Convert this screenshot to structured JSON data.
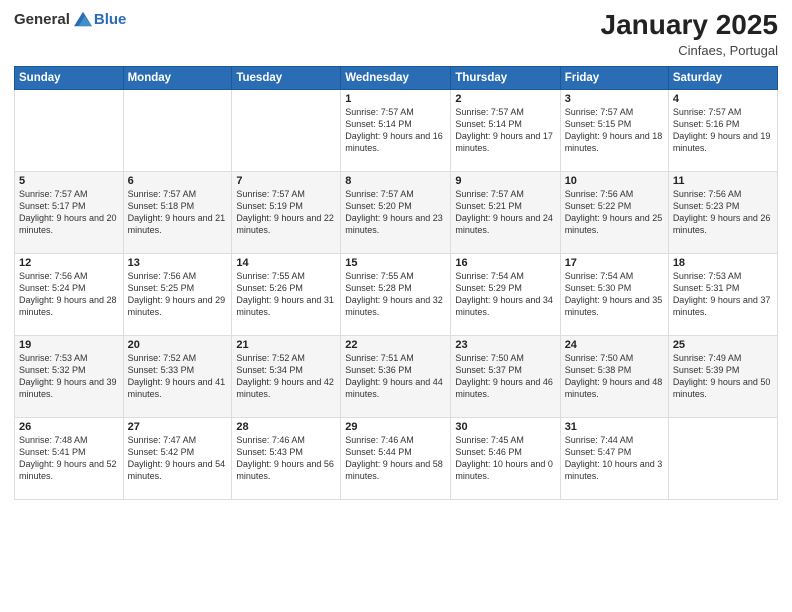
{
  "logo": {
    "text_general": "General",
    "text_blue": "Blue"
  },
  "header": {
    "month": "January 2025",
    "location": "Cinfaes, Portugal"
  },
  "weekdays": [
    "Sunday",
    "Monday",
    "Tuesday",
    "Wednesday",
    "Thursday",
    "Friday",
    "Saturday"
  ],
  "weeks": [
    [
      {
        "day": "",
        "sunrise": "",
        "sunset": "",
        "daylight": ""
      },
      {
        "day": "",
        "sunrise": "",
        "sunset": "",
        "daylight": ""
      },
      {
        "day": "",
        "sunrise": "",
        "sunset": "",
        "daylight": ""
      },
      {
        "day": "1",
        "sunrise": "Sunrise: 7:57 AM",
        "sunset": "Sunset: 5:14 PM",
        "daylight": "Daylight: 9 hours and 16 minutes."
      },
      {
        "day": "2",
        "sunrise": "Sunrise: 7:57 AM",
        "sunset": "Sunset: 5:14 PM",
        "daylight": "Daylight: 9 hours and 17 minutes."
      },
      {
        "day": "3",
        "sunrise": "Sunrise: 7:57 AM",
        "sunset": "Sunset: 5:15 PM",
        "daylight": "Daylight: 9 hours and 18 minutes."
      },
      {
        "day": "4",
        "sunrise": "Sunrise: 7:57 AM",
        "sunset": "Sunset: 5:16 PM",
        "daylight": "Daylight: 9 hours and 19 minutes."
      }
    ],
    [
      {
        "day": "5",
        "sunrise": "Sunrise: 7:57 AM",
        "sunset": "Sunset: 5:17 PM",
        "daylight": "Daylight: 9 hours and 20 minutes."
      },
      {
        "day": "6",
        "sunrise": "Sunrise: 7:57 AM",
        "sunset": "Sunset: 5:18 PM",
        "daylight": "Daylight: 9 hours and 21 minutes."
      },
      {
        "day": "7",
        "sunrise": "Sunrise: 7:57 AM",
        "sunset": "Sunset: 5:19 PM",
        "daylight": "Daylight: 9 hours and 22 minutes."
      },
      {
        "day": "8",
        "sunrise": "Sunrise: 7:57 AM",
        "sunset": "Sunset: 5:20 PM",
        "daylight": "Daylight: 9 hours and 23 minutes."
      },
      {
        "day": "9",
        "sunrise": "Sunrise: 7:57 AM",
        "sunset": "Sunset: 5:21 PM",
        "daylight": "Daylight: 9 hours and 24 minutes."
      },
      {
        "day": "10",
        "sunrise": "Sunrise: 7:56 AM",
        "sunset": "Sunset: 5:22 PM",
        "daylight": "Daylight: 9 hours and 25 minutes."
      },
      {
        "day": "11",
        "sunrise": "Sunrise: 7:56 AM",
        "sunset": "Sunset: 5:23 PM",
        "daylight": "Daylight: 9 hours and 26 minutes."
      }
    ],
    [
      {
        "day": "12",
        "sunrise": "Sunrise: 7:56 AM",
        "sunset": "Sunset: 5:24 PM",
        "daylight": "Daylight: 9 hours and 28 minutes."
      },
      {
        "day": "13",
        "sunrise": "Sunrise: 7:56 AM",
        "sunset": "Sunset: 5:25 PM",
        "daylight": "Daylight: 9 hours and 29 minutes."
      },
      {
        "day": "14",
        "sunrise": "Sunrise: 7:55 AM",
        "sunset": "Sunset: 5:26 PM",
        "daylight": "Daylight: 9 hours and 31 minutes."
      },
      {
        "day": "15",
        "sunrise": "Sunrise: 7:55 AM",
        "sunset": "Sunset: 5:28 PM",
        "daylight": "Daylight: 9 hours and 32 minutes."
      },
      {
        "day": "16",
        "sunrise": "Sunrise: 7:54 AM",
        "sunset": "Sunset: 5:29 PM",
        "daylight": "Daylight: 9 hours and 34 minutes."
      },
      {
        "day": "17",
        "sunrise": "Sunrise: 7:54 AM",
        "sunset": "Sunset: 5:30 PM",
        "daylight": "Daylight: 9 hours and 35 minutes."
      },
      {
        "day": "18",
        "sunrise": "Sunrise: 7:53 AM",
        "sunset": "Sunset: 5:31 PM",
        "daylight": "Daylight: 9 hours and 37 minutes."
      }
    ],
    [
      {
        "day": "19",
        "sunrise": "Sunrise: 7:53 AM",
        "sunset": "Sunset: 5:32 PM",
        "daylight": "Daylight: 9 hours and 39 minutes."
      },
      {
        "day": "20",
        "sunrise": "Sunrise: 7:52 AM",
        "sunset": "Sunset: 5:33 PM",
        "daylight": "Daylight: 9 hours and 41 minutes."
      },
      {
        "day": "21",
        "sunrise": "Sunrise: 7:52 AM",
        "sunset": "Sunset: 5:34 PM",
        "daylight": "Daylight: 9 hours and 42 minutes."
      },
      {
        "day": "22",
        "sunrise": "Sunrise: 7:51 AM",
        "sunset": "Sunset: 5:36 PM",
        "daylight": "Daylight: 9 hours and 44 minutes."
      },
      {
        "day": "23",
        "sunrise": "Sunrise: 7:50 AM",
        "sunset": "Sunset: 5:37 PM",
        "daylight": "Daylight: 9 hours and 46 minutes."
      },
      {
        "day": "24",
        "sunrise": "Sunrise: 7:50 AM",
        "sunset": "Sunset: 5:38 PM",
        "daylight": "Daylight: 9 hours and 48 minutes."
      },
      {
        "day": "25",
        "sunrise": "Sunrise: 7:49 AM",
        "sunset": "Sunset: 5:39 PM",
        "daylight": "Daylight: 9 hours and 50 minutes."
      }
    ],
    [
      {
        "day": "26",
        "sunrise": "Sunrise: 7:48 AM",
        "sunset": "Sunset: 5:41 PM",
        "daylight": "Daylight: 9 hours and 52 minutes."
      },
      {
        "day": "27",
        "sunrise": "Sunrise: 7:47 AM",
        "sunset": "Sunset: 5:42 PM",
        "daylight": "Daylight: 9 hours and 54 minutes."
      },
      {
        "day": "28",
        "sunrise": "Sunrise: 7:46 AM",
        "sunset": "Sunset: 5:43 PM",
        "daylight": "Daylight: 9 hours and 56 minutes."
      },
      {
        "day": "29",
        "sunrise": "Sunrise: 7:46 AM",
        "sunset": "Sunset: 5:44 PM",
        "daylight": "Daylight: 9 hours and 58 minutes."
      },
      {
        "day": "30",
        "sunrise": "Sunrise: 7:45 AM",
        "sunset": "Sunset: 5:46 PM",
        "daylight": "Daylight: 10 hours and 0 minutes."
      },
      {
        "day": "31",
        "sunrise": "Sunrise: 7:44 AM",
        "sunset": "Sunset: 5:47 PM",
        "daylight": "Daylight: 10 hours and 3 minutes."
      },
      {
        "day": "",
        "sunrise": "",
        "sunset": "",
        "daylight": ""
      }
    ]
  ]
}
